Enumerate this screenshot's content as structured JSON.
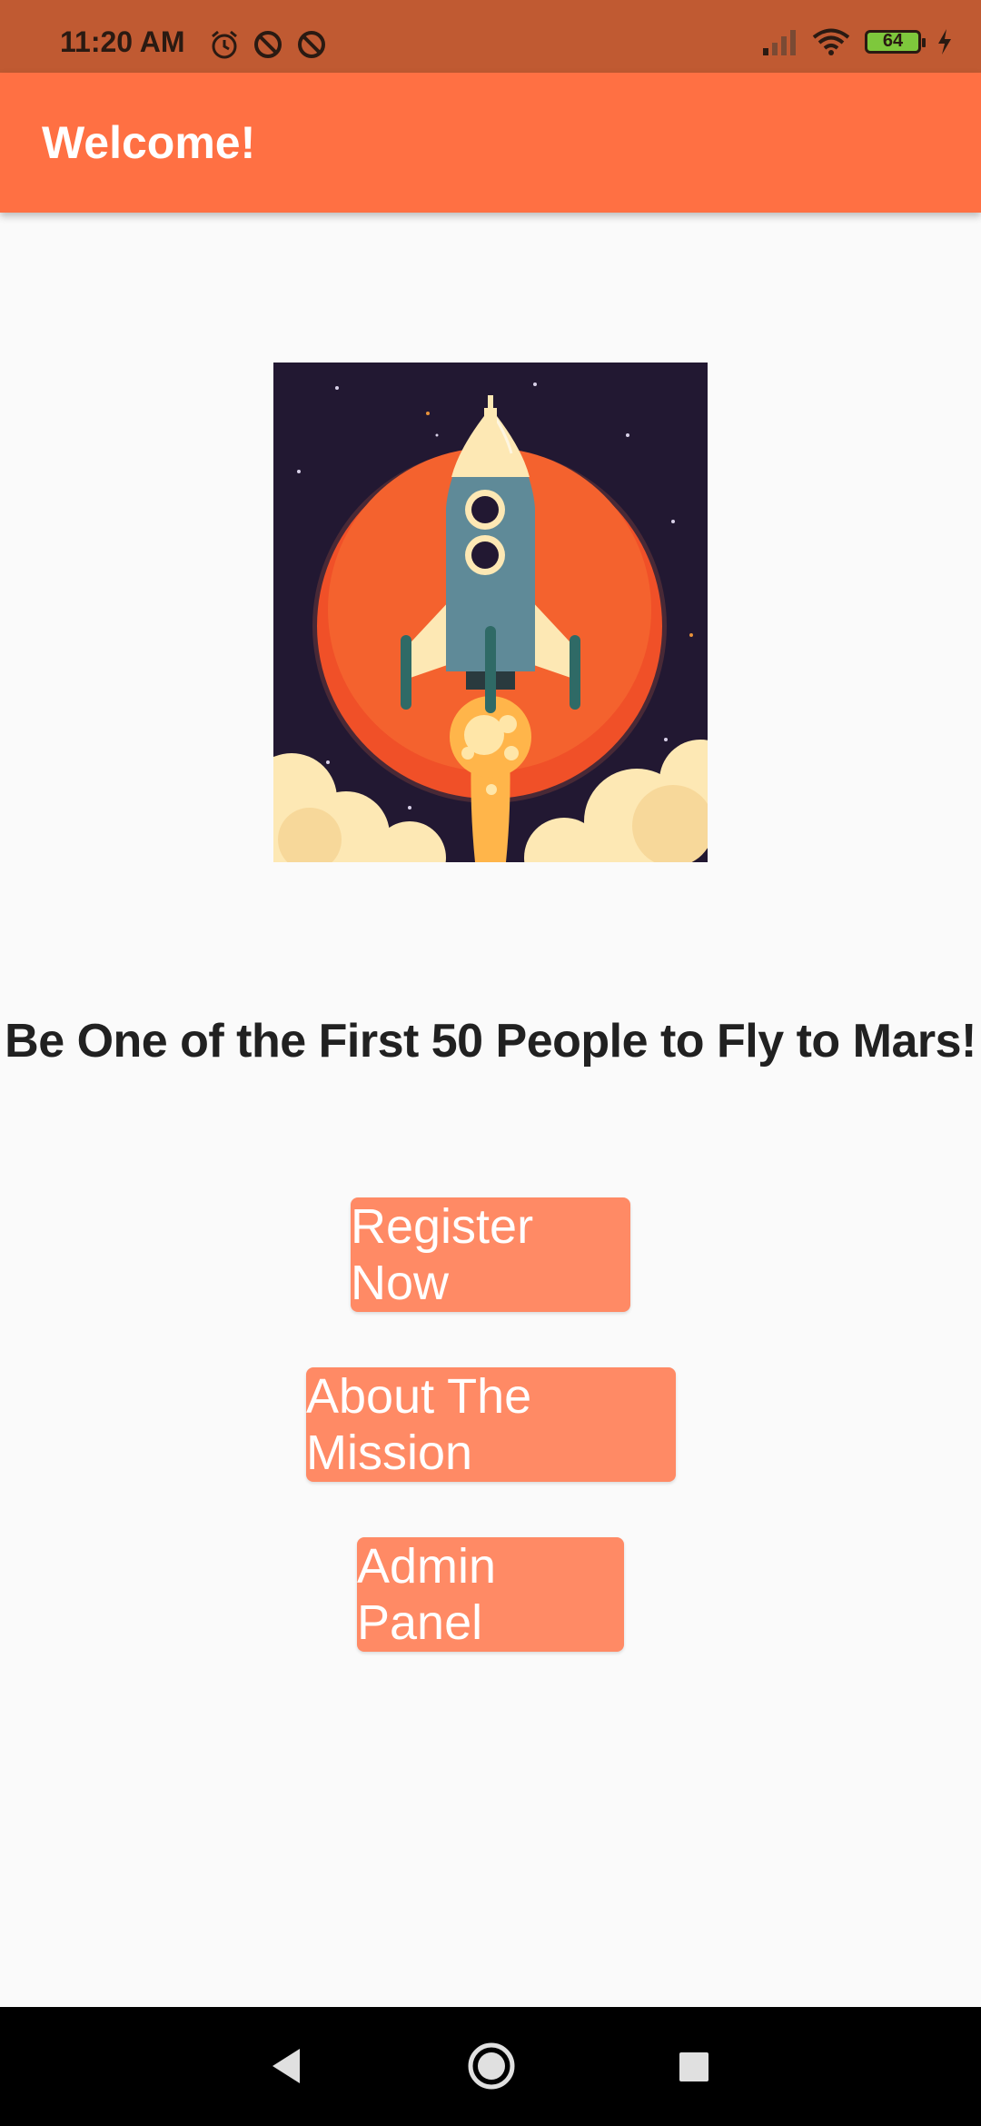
{
  "status_bar": {
    "time": "11:20 AM",
    "battery_level": "64",
    "icons": [
      "alarm-icon",
      "do-not-disturb-icon",
      "do-not-disturb-icon",
      "signal-icon",
      "wifi-icon",
      "battery-icon",
      "charging-icon"
    ]
  },
  "app_bar": {
    "title": "Welcome!"
  },
  "hero": {
    "image": "rocket-launch-illustration"
  },
  "headline": "Be One of the First 50 People to Fly to Mars!",
  "buttons": {
    "register": "Register Now",
    "about": "About The Mission",
    "admin": "Admin Panel"
  },
  "nav_bar": {
    "icons": [
      "back-icon",
      "home-icon",
      "recents-icon"
    ]
  },
  "colors": {
    "status_bar": "#c05a32",
    "app_bar": "#ff7043",
    "button": "#ff8a65",
    "background": "#fafafa"
  }
}
